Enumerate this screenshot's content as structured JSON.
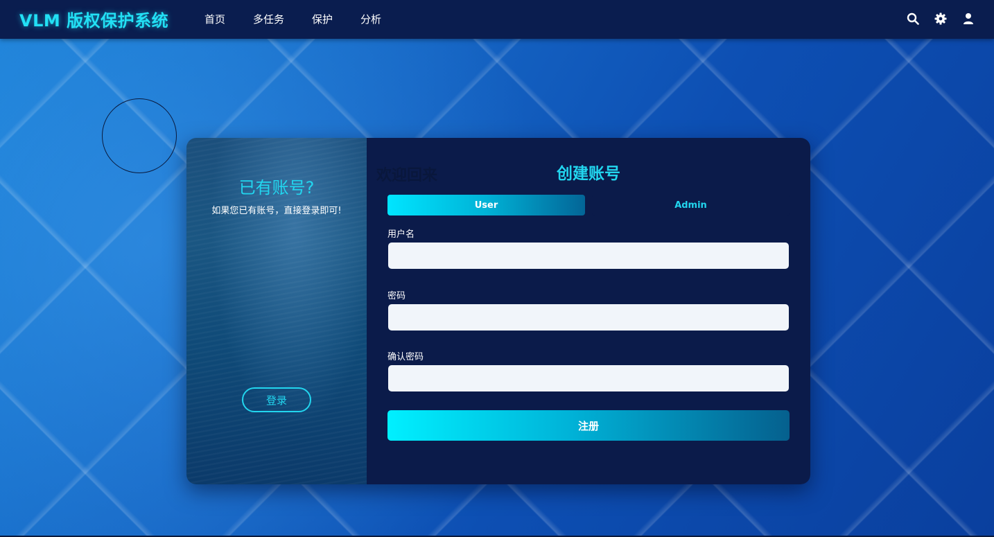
{
  "navbar": {
    "brand": "VLM 版权保护系统",
    "links": [
      "首页",
      "多任务",
      "保护",
      "分析"
    ],
    "icons": [
      "search-icon",
      "gear-icon",
      "user-icon"
    ]
  },
  "card": {
    "left": {
      "title": "已有账号?",
      "subtitle": "如果您已有账号，直接登录即可!",
      "login_label": "登录"
    },
    "right": {
      "ghost_text": "欢迎回来",
      "title": "创建账号",
      "tabs": [
        {
          "label": "User",
          "active": true
        },
        {
          "label": "Admin",
          "active": false
        }
      ],
      "fields": [
        {
          "label": "用户名",
          "value": "",
          "placeholder": ""
        },
        {
          "label": "密码",
          "value": "",
          "placeholder": ""
        },
        {
          "label": "确认密码",
          "value": "",
          "placeholder": ""
        }
      ],
      "submit_label": "注册"
    }
  },
  "colors": {
    "accent": "#22d6ef",
    "navbar_bg": "#0a1d4f",
    "card_bg": "#0b1b4a",
    "input_bg": "#f1f5fa"
  }
}
